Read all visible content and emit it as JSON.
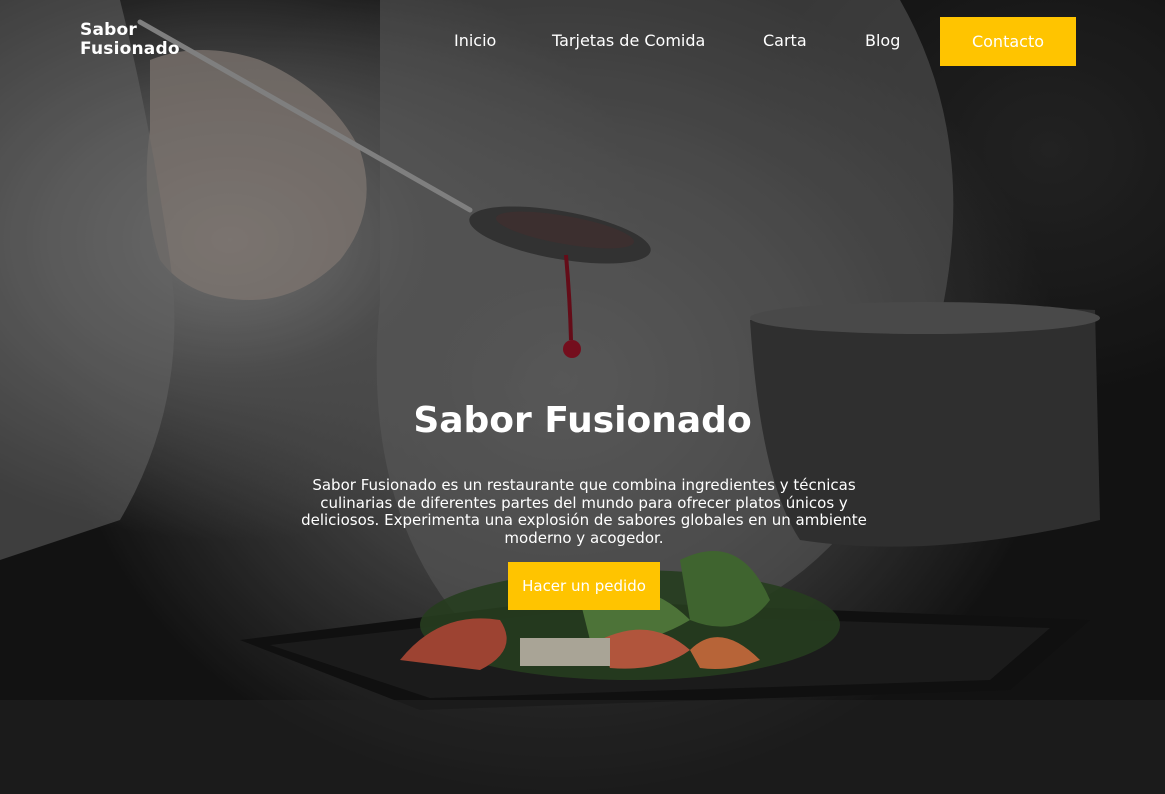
{
  "brand": {
    "logo_line1": "Sabor",
    "logo_line2": "Fusionado"
  },
  "nav": {
    "items": [
      {
        "label": "Inicio"
      },
      {
        "label": "Tarjetas de Comida"
      },
      {
        "label": "Carta"
      },
      {
        "label": "Blog"
      }
    ],
    "cta_label": "Contacto"
  },
  "hero": {
    "title": "Sabor Fusionado",
    "description": "Sabor Fusionado es un restaurante que combina ingredientes y técnicas culinarias de diferentes partes del mundo para ofrecer platos únicos y deliciosos. Experimenta una explosión de sabores globales en un ambiente moderno y acogedor.",
    "cta_label": "Hacer un pedido"
  },
  "colors": {
    "accent": "#ffc400",
    "text": "#ffffff"
  }
}
